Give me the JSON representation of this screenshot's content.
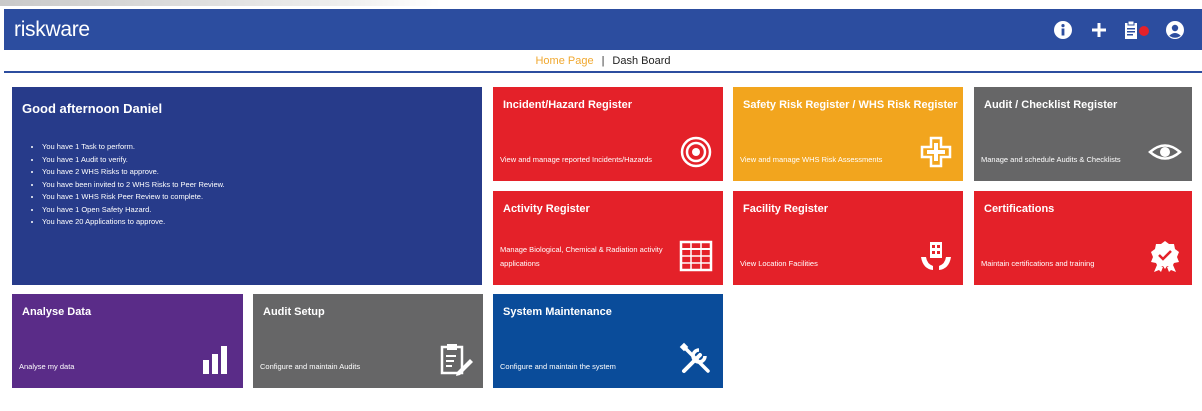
{
  "header": {
    "logo_text": "riskware",
    "icons": [
      "info-icon",
      "add-icon",
      "clipboard-notification-icon",
      "user-account-icon"
    ],
    "notification_count": "0"
  },
  "breadcrumb": {
    "home": "Home Page",
    "separator": "|",
    "current": "Dash Board"
  },
  "welcome": {
    "greeting": "Good afternoon Daniel",
    "items": [
      "You have 1 Task to perform.",
      "You have 1 Audit to verify.",
      "You have 2 WHS Risks to approve.",
      "You have been invited to 2 WHS Risks to Peer Review.",
      "You have 1 WHS Risk Peer Review to complete.",
      "You have 1 Open Safety Hazard.",
      "You have 20 Applications to approve."
    ]
  },
  "tiles": {
    "incident": {
      "title": "Incident/Hazard Register",
      "desc": "View and manage reported Incidents/Hazards",
      "icon": "target-icon",
      "color": "#e42129"
    },
    "safety_risk": {
      "title": "Safety Risk Register / WHS Risk Register",
      "desc": "View and manage WHS Risk Assessments",
      "icon": "medical-cross-icon",
      "color": "#f2a51e"
    },
    "audit_checklist": {
      "title": "Audit / Checklist Register",
      "desc": "Manage and schedule Audits & Checklists",
      "icon": "eye-icon",
      "color": "#666667"
    },
    "activity": {
      "title": "Activity Register",
      "desc": "Manage Biological, Chemical & Radiation activity applications",
      "icon": "table-grid-icon",
      "color": "#e42129"
    },
    "facility": {
      "title": "Facility Register",
      "desc": "View Location Facilities",
      "icon": "building-hands-icon",
      "color": "#e42129"
    },
    "certifications": {
      "title": "Certifications",
      "desc": "Maintain certifications and training",
      "icon": "award-ribbon-icon",
      "color": "#e42129"
    },
    "analyse": {
      "title": "Analyse Data",
      "desc": "Analyse my data",
      "icon": "bar-chart-icon",
      "color": "#5a2c88"
    },
    "audit_setup": {
      "title": "Audit Setup",
      "desc": "Configure and maintain Audits",
      "icon": "clipboard-edit-icon",
      "color": "#666667"
    },
    "system_maintenance": {
      "title": "System Maintenance",
      "desc": "Configure and maintain the system",
      "icon": "tools-icon",
      "color": "#0a4c9a"
    }
  }
}
